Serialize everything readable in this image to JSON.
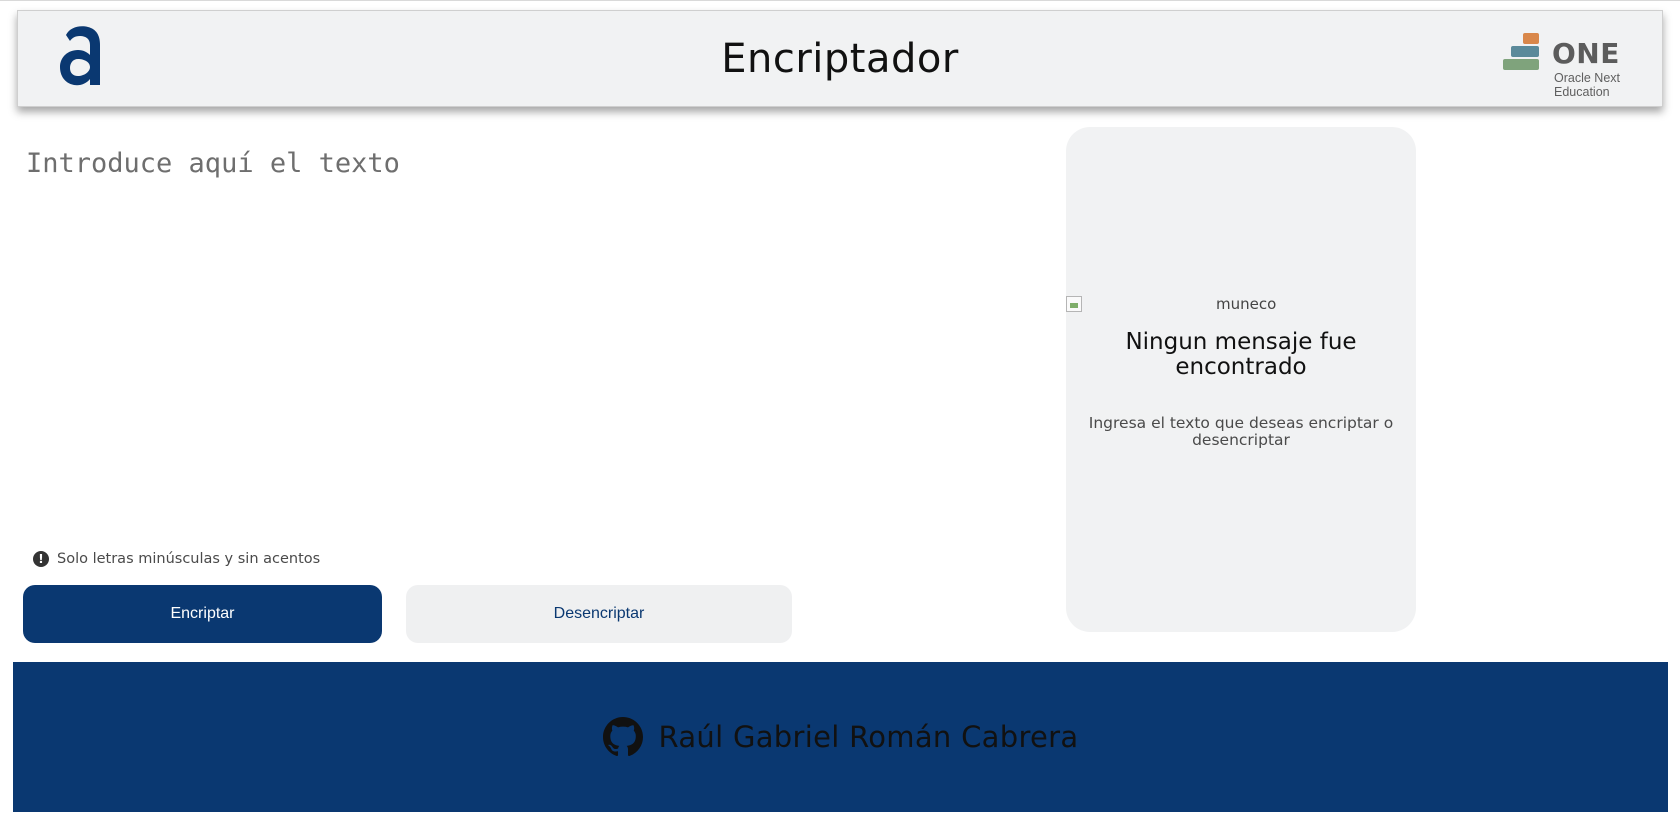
{
  "header": {
    "logo_icon": "alura-a-logo-icon",
    "title": "Encriptador",
    "partner_logo": {
      "icon": "oracle-one-logo-icon",
      "word": "ONE",
      "sub_line1": "Oracle Next",
      "sub_line2": "Education"
    }
  },
  "input": {
    "placeholder": "Introduce aquí el texto",
    "value": ""
  },
  "hint": {
    "icon": "exclamation-circle-icon",
    "text": "Solo letras minúsculas y sin acentos"
  },
  "buttons": {
    "encrypt_label": "Encriptar",
    "decrypt_label": "Desencriptar"
  },
  "result": {
    "image_alt": "muneco",
    "title": "Ningun mensaje fue encontrado",
    "message": "Ingresa el texto que deseas encriptar o desencriptar"
  },
  "footer": {
    "icon": "github-icon",
    "author": "Raúl Gabriel Román Cabrera"
  },
  "colors": {
    "primary": "#0a3871",
    "header_bg": "#f1f2f3",
    "panel_bg": "#f1f2f3",
    "secondary_button_bg": "#eff0f1"
  }
}
